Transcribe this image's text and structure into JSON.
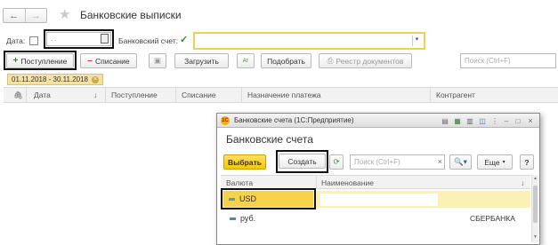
{
  "header": {
    "nav_back": "←",
    "nav_forward": "→",
    "title": "Банковские выписки"
  },
  "filters": {
    "date_label": "Дата:",
    "date_value": ". .",
    "bank_account_label": "Банковский счет:",
    "bank_account_checked": true
  },
  "toolbar": {
    "income_label": "Поступление",
    "writeoff_label": "Списание",
    "load_label": "Загрузить",
    "select_label": "Подобрать",
    "registry_label": "Реестр документов",
    "search_placeholder": "Поиск (Ctrl+F)"
  },
  "period": {
    "text": "01.11.2018 - 30.11.2018"
  },
  "table": {
    "columns": {
      "date": "Дата",
      "sort": "↓",
      "income": "Поступление",
      "writeoff": "Списание",
      "purpose": "Назначение платежа",
      "counterparty": "Контрагент"
    }
  },
  "dialog": {
    "window_title": "Банковские счета (1С:Предприятие)",
    "heading": "Банковские счета",
    "select_label": "Выбрать",
    "create_label": "Создать",
    "search_placeholder": "Поиск (Ctrl+F)",
    "clear": "×",
    "more_label": "Еще",
    "help_label": "?",
    "columns": {
      "currency": "Валюта",
      "name": "Наименование",
      "sort": "↓"
    },
    "rows": [
      {
        "currency": "USD",
        "name": ""
      },
      {
        "currency": "руб.",
        "name": "СБЕРБАНКА"
      }
    ]
  },
  "colors": {
    "accent_yellow": "#f6c800",
    "field_highlight": "#f0d050",
    "period_bg": "#f3e3a3",
    "selected_row": "#fbf0b5"
  }
}
